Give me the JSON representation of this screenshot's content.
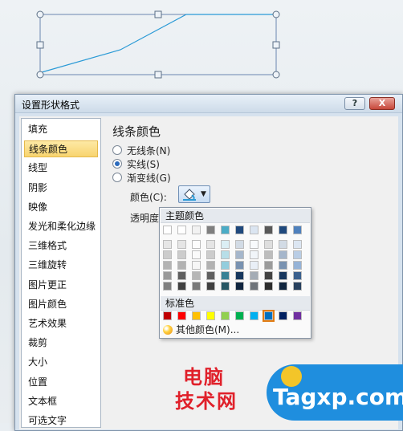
{
  "dialog": {
    "title": "设置形状格式",
    "help_label": "?",
    "close_label": "X"
  },
  "categories": [
    "填充",
    "线条颜色",
    "线型",
    "阴影",
    "映像",
    "发光和柔化边缘",
    "三维格式",
    "三维旋转",
    "图片更正",
    "图片颜色",
    "艺术效果",
    "裁剪",
    "大小",
    "位置",
    "文本框",
    "可选文字"
  ],
  "active_category": "线条颜色",
  "panel": {
    "title": "线条颜色",
    "options": [
      {
        "label": "无线条(N)",
        "selected": false
      },
      {
        "label": "实线(S)",
        "selected": true
      },
      {
        "label": "渐变线(G)",
        "selected": false
      }
    ],
    "color_label": "颜色(C):",
    "transparency_label": "透明度(T):"
  },
  "color_popup": {
    "theme_header": "主题颜色",
    "standard_header": "标准色",
    "more_colors": "其他颜色(M)...",
    "theme_base": [
      "#ffffff",
      "#000000",
      "#eeece1",
      "#1f497d",
      "#4f81bd",
      "#c0504d",
      "#9bbb59",
      "#8064a2",
      "#4bacc6",
      "#f79646"
    ],
    "theme_base_display": [
      "#ffffff",
      "#f2f2f2",
      "#000000",
      "#7f7f7f",
      "#4bacc6",
      "#17375e",
      "#dbe5f1",
      "#595959",
      "#1f497d",
      "#4f81bd"
    ],
    "standard": [
      "#c00000",
      "#ff0000",
      "#ffc000",
      "#ffff00",
      "#92d050",
      "#00b050",
      "#00b0f0",
      "#0070c0",
      "#002060",
      "#7030a0"
    ],
    "selected_standard_index": 7
  },
  "watermark": {
    "line1": "电脑",
    "line2": "技术网",
    "site": "Tagxp.com"
  },
  "icons": {
    "paint": "paint-bucket-icon",
    "dropdown": "chevron-down-icon",
    "palette": "palette-icon"
  }
}
